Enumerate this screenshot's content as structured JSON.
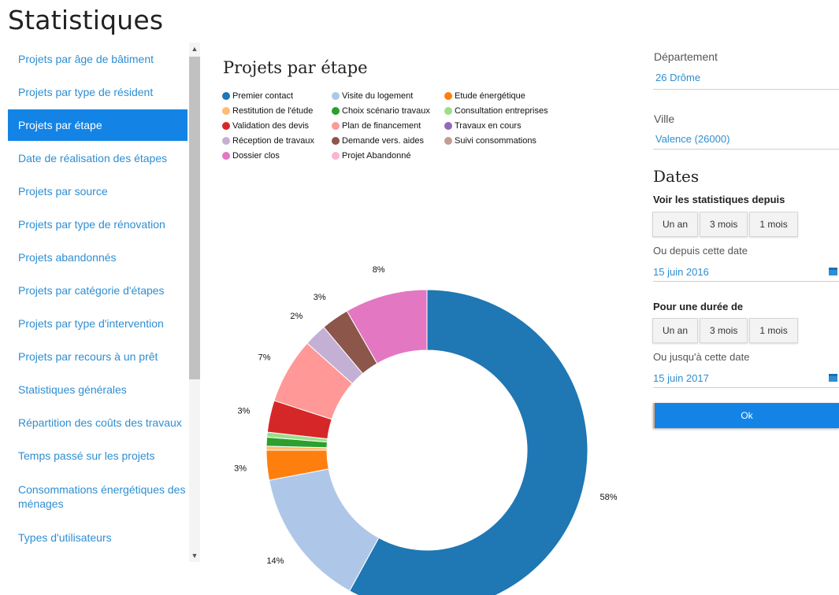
{
  "page": {
    "title": "Statistiques"
  },
  "sidebar": {
    "items": [
      {
        "label": "Projets par âge de bâtiment",
        "active": false
      },
      {
        "label": "Projets par type de résident",
        "active": false
      },
      {
        "label": "Projets par étape",
        "active": true
      },
      {
        "label": "Date de réalisation des étapes",
        "active": false
      },
      {
        "label": "Projets par source",
        "active": false
      },
      {
        "label": "Projets par type de rénovation",
        "active": false
      },
      {
        "label": "Projets abandonnés",
        "active": false
      },
      {
        "label": "Projets par catégorie d'étapes",
        "active": false
      },
      {
        "label": "Projets par type d'intervention",
        "active": false
      },
      {
        "label": "Projets par recours à un prêt",
        "active": false
      },
      {
        "label": "Statistiques générales",
        "active": false
      },
      {
        "label": "Répartition des coûts des travaux",
        "active": false
      },
      {
        "label": "Temps passé sur les projets",
        "active": false
      },
      {
        "label": "Consommations énergétiques des ménages",
        "active": false
      },
      {
        "label": "Types d'utilisateurs",
        "active": false
      }
    ],
    "scroll_up_icon": "▲",
    "scroll_down_icon": "▼"
  },
  "filters": {
    "department_label": "Département",
    "department_value": "26 Drôme",
    "city_label": "Ville",
    "city_value": "Valence (26000)",
    "dates_title": "Dates",
    "since_label": "Voir les statistiques depuis",
    "since_buttons": [
      "Un an",
      "3 mois",
      "1 mois"
    ],
    "since_date_label": "Ou depuis cette date",
    "since_date_value": "15 juin 2016",
    "duration_label": "Pour une durée de",
    "duration_buttons": [
      "Un an",
      "3 mois",
      "1 mois"
    ],
    "until_date_label": "Ou jusqu'à cette date",
    "until_date_value": "15 juin 2017",
    "ok_label": "Ok",
    "calendar_icon": "calendar-icon"
  },
  "chart_data": {
    "type": "pie",
    "title": "Projets par étape",
    "donut": true,
    "start_angle_deg": 0,
    "legend_position": "top",
    "series": [
      {
        "name": "Premier contact",
        "value": 58.0,
        "label": "58%",
        "color": "#1f77b4"
      },
      {
        "name": "Visite du logement",
        "value": 14.0,
        "label": "14%",
        "color": "#aec7e8"
      },
      {
        "name": "Etude énergétique",
        "value": 3.0,
        "label": "3%",
        "color": "#ff7f0e"
      },
      {
        "name": "Restitution de l'étude",
        "value": 0.4,
        "label": "",
        "color": "#ffbb78"
      },
      {
        "name": "Choix scénario travaux",
        "value": 0.9,
        "label": "",
        "color": "#2ca02c"
      },
      {
        "name": "Consultation entreprises",
        "value": 0.5,
        "label": "",
        "color": "#98df8a"
      },
      {
        "name": "Validation des devis",
        "value": 3.2,
        "label": "3%",
        "color": "#d62728"
      },
      {
        "name": "Plan de financement",
        "value": 6.6,
        "label": "7%",
        "color": "#ff9896"
      },
      {
        "name": "Travaux en cours",
        "value": 0.0,
        "label": "",
        "color": "#9467bd"
      },
      {
        "name": "Réception de travaux",
        "value": 2.3,
        "label": "2%",
        "color": "#c5b0d5"
      },
      {
        "name": "Demande vers. aides",
        "value": 2.8,
        "label": "3%",
        "color": "#8c564b"
      },
      {
        "name": "Suivi consommations",
        "value": 0.0,
        "label": "",
        "color": "#c49c94"
      },
      {
        "name": "Dossier clos",
        "value": 8.3,
        "label": "8%",
        "color": "#e377c2"
      },
      {
        "name": "Projet Abandonné",
        "value": 0.0,
        "label": "",
        "color": "#f7b6d2"
      }
    ]
  }
}
